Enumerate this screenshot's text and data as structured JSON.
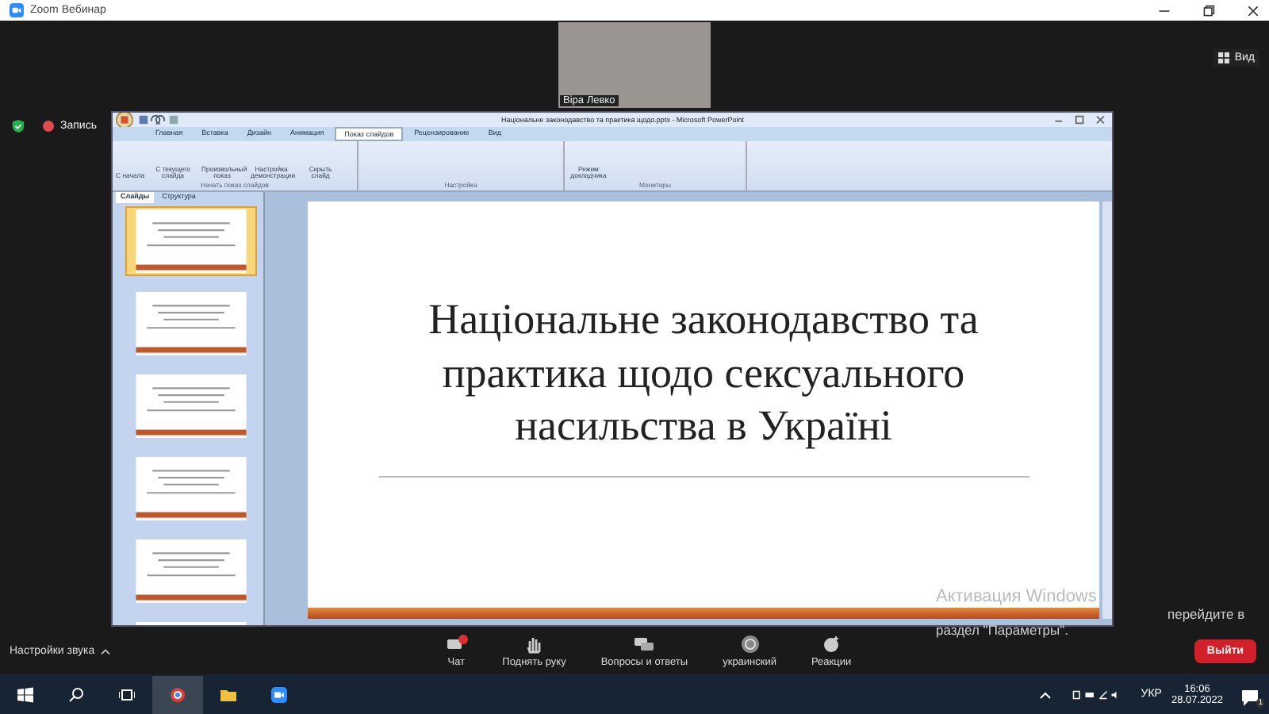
{
  "window": {
    "title": "Zoom Вебинар"
  },
  "video": {
    "name": "Віра Левко"
  },
  "view_button": {
    "label": "Вид"
  },
  "recording": {
    "label": "Запись",
    "on": true
  },
  "powerpoint": {
    "title": "Національне законодавство та практика щодо.pptx - Microsoft PowerPoint",
    "tabs": [
      {
        "label": "Главная",
        "selected": false
      },
      {
        "label": "Вставка",
        "selected": false
      },
      {
        "label": "Дизайн",
        "selected": false
      },
      {
        "label": "Анимация",
        "selected": false
      },
      {
        "label": "Показ слайдов",
        "selected": true
      },
      {
        "label": "Рецензирование",
        "selected": false
      },
      {
        "label": "Вид",
        "selected": false
      }
    ],
    "groups": [
      {
        "label": "Начать показ слайдов",
        "buttons": [
          "С начала",
          "С текущего слайда",
          "Произвольный показ",
          "Настройка демонстрации",
          "Скрыть слайд"
        ]
      },
      {
        "label": "Настройка"
      },
      {
        "label": "Мониторы",
        "buttons": [
          "Режим докладчика"
        ]
      }
    ],
    "pane_tabs": [
      {
        "label": "Слайды",
        "selected": true
      },
      {
        "label": "Структура",
        "selected": false
      }
    ],
    "thumbnails": [
      {
        "selected": true
      },
      {
        "selected": false
      },
      {
        "selected": false
      },
      {
        "selected": false
      },
      {
        "selected": false
      },
      {
        "selected": false
      }
    ],
    "slide_title": "Національне законодавство та практика щодо сексуального насильства в Україні"
  },
  "activation": {
    "title": "Активация Windows",
    "lines": [
      "перейдите в",
      "раздел \"Параметры\"."
    ]
  },
  "audio": {
    "label": "Настройки звука"
  },
  "toolbar": [
    {
      "kind": "chat",
      "label": "Чат"
    },
    {
      "kind": "hand",
      "label": "Поднять руку"
    },
    {
      "kind": "qa",
      "label": "Вопросы и ответы"
    },
    {
      "kind": "lang",
      "label": "украинский"
    },
    {
      "kind": "react",
      "label": "Реакции"
    }
  ],
  "leave_button": {
    "label": "Выйти"
  },
  "taskbar": {
    "language": "УКР",
    "time": "16:06",
    "date": "28.07.2022",
    "notifications": "1"
  }
}
